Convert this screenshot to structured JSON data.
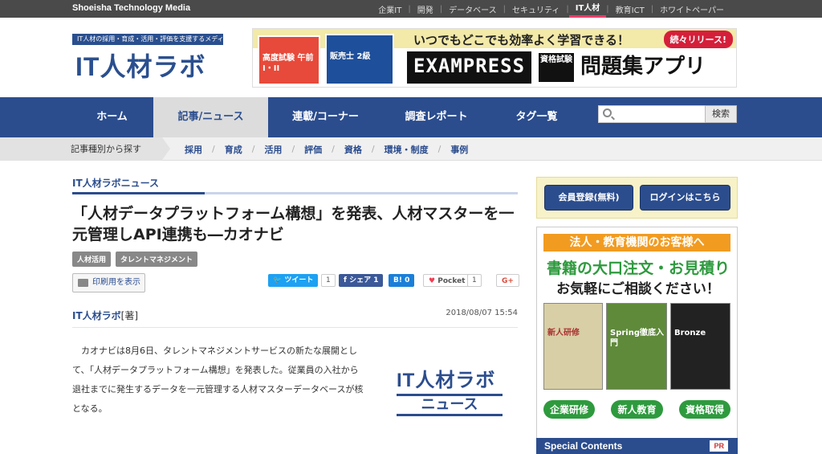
{
  "topbar": {
    "brand": "Shoeisha Technology Media",
    "links": [
      "企業IT",
      "開発",
      "データベース",
      "セキュリティ",
      "IT人材",
      "教育ICT",
      "ホワイトペーパー"
    ],
    "active": "IT人材"
  },
  "header": {
    "tagline": "IT人材の採用・育成・活用・評価を支援するメディア",
    "logo": "IT人材ラボ",
    "banner": {
      "headline": "いつでもどこでも効率よく学習できる！",
      "badge": "続々リリース!",
      "exam": "EXAMPRESS",
      "sub": "資格試験",
      "app": "問題集アプリ",
      "book1": "高度試験 午前I・II",
      "book2": "販売士 2級"
    }
  },
  "nav": {
    "items": [
      "ホーム",
      "記事/ニュース",
      "連載/コーナー",
      "調査レポート",
      "タグ一覧"
    ],
    "active": "記事/ニュース",
    "search_placeholder": "",
    "search_button": "検索"
  },
  "subnav": {
    "lead": "記事種別から探す",
    "categories": [
      "採用",
      "育成",
      "活用",
      "評価",
      "資格",
      "環境・制度",
      "事例"
    ]
  },
  "article": {
    "section": "IT人材ラボニュース",
    "title": "「人材データプラットフォーム構想」を発表、人材マスターを一元管理しAPI連携も―カオナビ",
    "tags": [
      "人材活用",
      "タレントマネジメント"
    ],
    "print_label": "印刷用を表示",
    "share": {
      "tweet": "ツイート",
      "tweet_count": "1",
      "fb": "シェア",
      "fb_count": "1",
      "hatena": "B!",
      "hatena_count": "0",
      "pocket": "Pocket",
      "pocket_count": "1",
      "gplus": "G+"
    },
    "author": "IT人材ラボ",
    "author_role": "[著]",
    "date": "2018/08/07 15:54",
    "body": "カオナビは8月6日、タレントマネジメントサービスの新たな展開として、「人材データプラットフォーム構想」を発表した。従業員の入社から退社までに発生するデータを一元管理する人材マスターデータベースが核となる。",
    "logo_top": "IT人材ラボ",
    "logo_bottom": "ニュース"
  },
  "sidebar": {
    "register": "会員登録(無料)",
    "login": "ログインはこちら",
    "ad": {
      "header": "法人・教育機関のお客様へ",
      "line1": "書籍の大口注文・お見積り",
      "line2": "お気軽にご相談ください！",
      "books": [
        "新人研修",
        "Spring徹底入門",
        "Bronze"
      ],
      "buttons": [
        "企業研修",
        "新人教育",
        "資格取得"
      ]
    },
    "special": "Special Contents",
    "pr": "PR"
  },
  "colors": {
    "navy": "#2b4d8e",
    "accent_pink": "#e83e6a",
    "green": "#2e9a3e",
    "orange": "#f29b21"
  }
}
